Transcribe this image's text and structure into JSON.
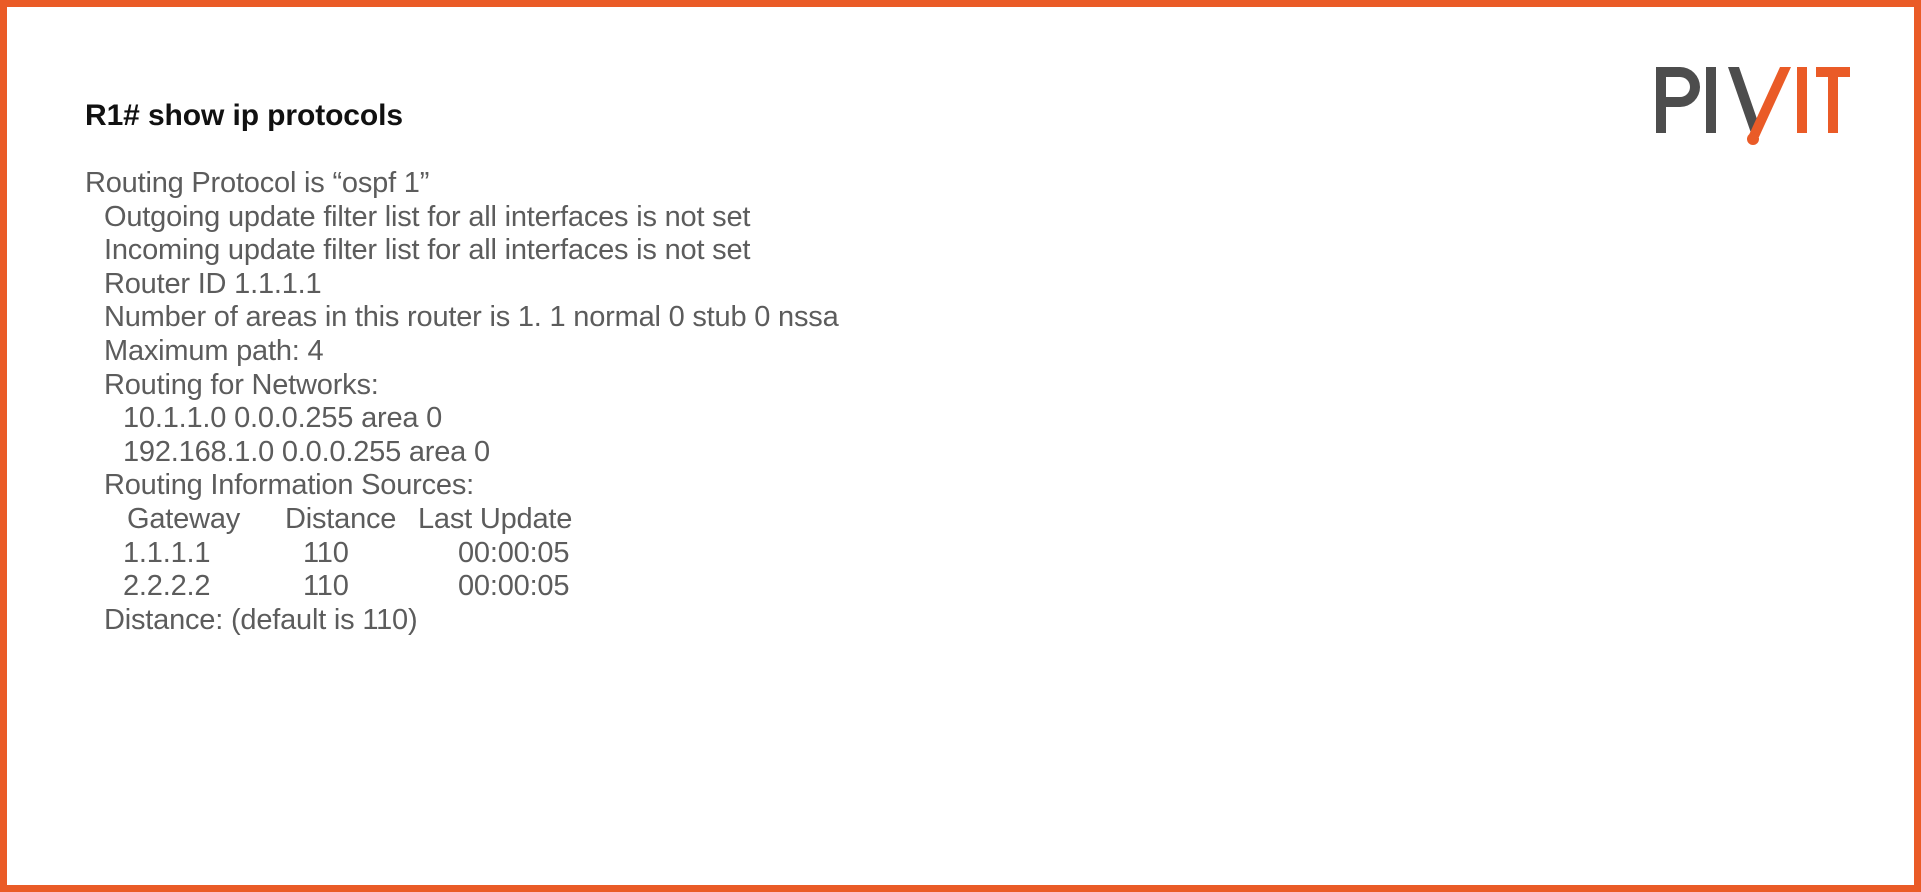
{
  "border_color": "#ea5b27",
  "background_color": "#ffffff",
  "logo": {
    "name": "pivit-logo",
    "text_dark": "PIV",
    "text_accent": "IT",
    "dark_color": "#4d4d4d",
    "accent_color": "#ea5b27"
  },
  "command": {
    "prompt": "R1#",
    "text": "R1# show ip protocols"
  },
  "output": {
    "lines": [
      {
        "indent": 0,
        "text": "Routing Protocol is “ospf 1”"
      },
      {
        "indent": 1,
        "text": "Outgoing update filter list for all interfaces is not set"
      },
      {
        "indent": 1,
        "text": "Incoming update filter list for all interfaces is not set"
      },
      {
        "indent": 1,
        "text": "Router ID 1.1.1.1"
      },
      {
        "indent": 1,
        "text": "Number of areas in this router is 1. 1 normal 0 stub 0 nssa"
      },
      {
        "indent": 1,
        "text": "Maximum path: 4"
      },
      {
        "indent": 1,
        "text": "Routing for Networks:"
      },
      {
        "indent": 2,
        "text": "10.1.1.0 0.0.0.255 area 0"
      },
      {
        "indent": 2,
        "text": "192.168.1.0 0.0.0.255 area 0"
      },
      {
        "indent": 1,
        "text": "Routing Information Sources:"
      }
    ],
    "sources_table": {
      "headers": [
        "Gateway",
        "Distance",
        "Last Update"
      ],
      "rows": [
        [
          "1.1.1.1",
          "110",
          "00:00:05"
        ],
        [
          "2.2.2.2",
          "110",
          "00:00:05"
        ]
      ]
    },
    "footer_line": {
      "indent": 1,
      "text": "Distance: (default is 110)"
    }
  }
}
